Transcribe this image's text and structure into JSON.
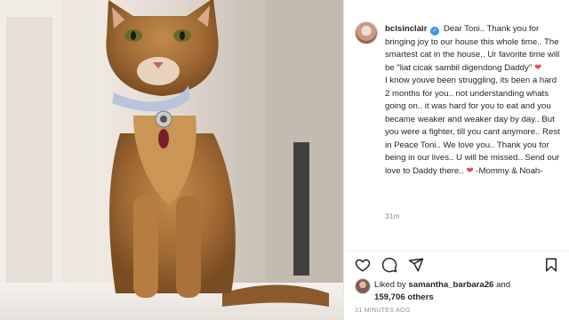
{
  "post": {
    "username": "bclsinclair",
    "caption_lines": [
      "Dear Toni.. Thank you for",
      "bringing joy to our house this whole",
      "time.. The smartest cat in the house..",
      "Ur favorite time will be \"liat cicak",
      "sambil digendong Daddy\"",
      "I know youve been struggling, its been",
      "a hard 2 months for you.. not",
      "understanding whats going on.. it was",
      "hard for you to eat and you became",
      "weaker and weaker day by day.. But",
      "you were a fighter, till you cant",
      "anymore.. Rest in Peace Toni.. We love",
      "you.. Thank you for being in our lives..",
      "U will be missed.. Send our love to",
      "Daddy there..",
      "-Mommy & Noah-"
    ],
    "time_ago": "31m",
    "liked_by_prefix": "Liked by",
    "liked_by_user": "samantha_barbara26",
    "liked_by_and": "and",
    "likes_count": "159,706 others",
    "timestamp": "31 MINUTES AGO",
    "verified_glyph": "✓",
    "heart_glyph": "❤"
  },
  "icons": [
    "heart-outline-icon",
    "comment-icon",
    "share-icon",
    "bookmark-icon"
  ],
  "colors": {
    "heart": "#ed4956",
    "verified": "#3897f0",
    "text": "#262626",
    "muted": "#8e8e8e"
  }
}
